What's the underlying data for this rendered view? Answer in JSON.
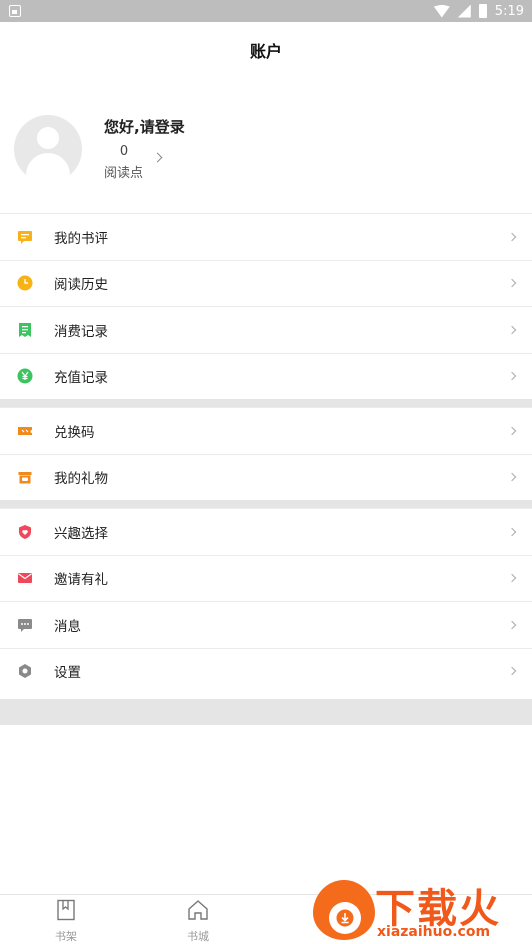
{
  "status_bar": {
    "time": "5:19"
  },
  "header": {
    "title": "账户"
  },
  "profile": {
    "greeting": "您好,请登录",
    "points_value": "0",
    "points_label": "阅读点"
  },
  "menu": {
    "items": [
      {
        "label": "我的书评",
        "icon": "review-icon",
        "color": "#f5b21b"
      },
      {
        "label": "阅读历史",
        "icon": "clock-icon",
        "color": "#f7b216"
      },
      {
        "label": "消费记录",
        "icon": "receipt-icon",
        "color": "#3cc461"
      },
      {
        "label": "充值记录",
        "icon": "yen-coin-icon",
        "color": "#3cc461"
      },
      {
        "label": "兑换码",
        "icon": "coupon-icon",
        "color": "#f08a1c"
      },
      {
        "label": "我的礼物",
        "icon": "gift-icon",
        "color": "#f08a1c"
      },
      {
        "label": "兴趣选择",
        "icon": "shield-heart-icon",
        "color": "#f0475a"
      },
      {
        "label": "邀请有礼",
        "icon": "envelope-icon",
        "color": "#f0475a"
      },
      {
        "label": "消息",
        "icon": "message-icon",
        "color": "#8a8a8a"
      },
      {
        "label": "设置",
        "icon": "gear-icon",
        "color": "#8a8a8a"
      }
    ]
  },
  "tabbar": {
    "tabs": [
      {
        "label": "书架",
        "icon": "bookshelf-icon"
      },
      {
        "label": "书城",
        "icon": "bookstore-home-icon"
      }
    ]
  },
  "watermark": {
    "title": "下载火",
    "url": "xiazaihuo.com"
  }
}
